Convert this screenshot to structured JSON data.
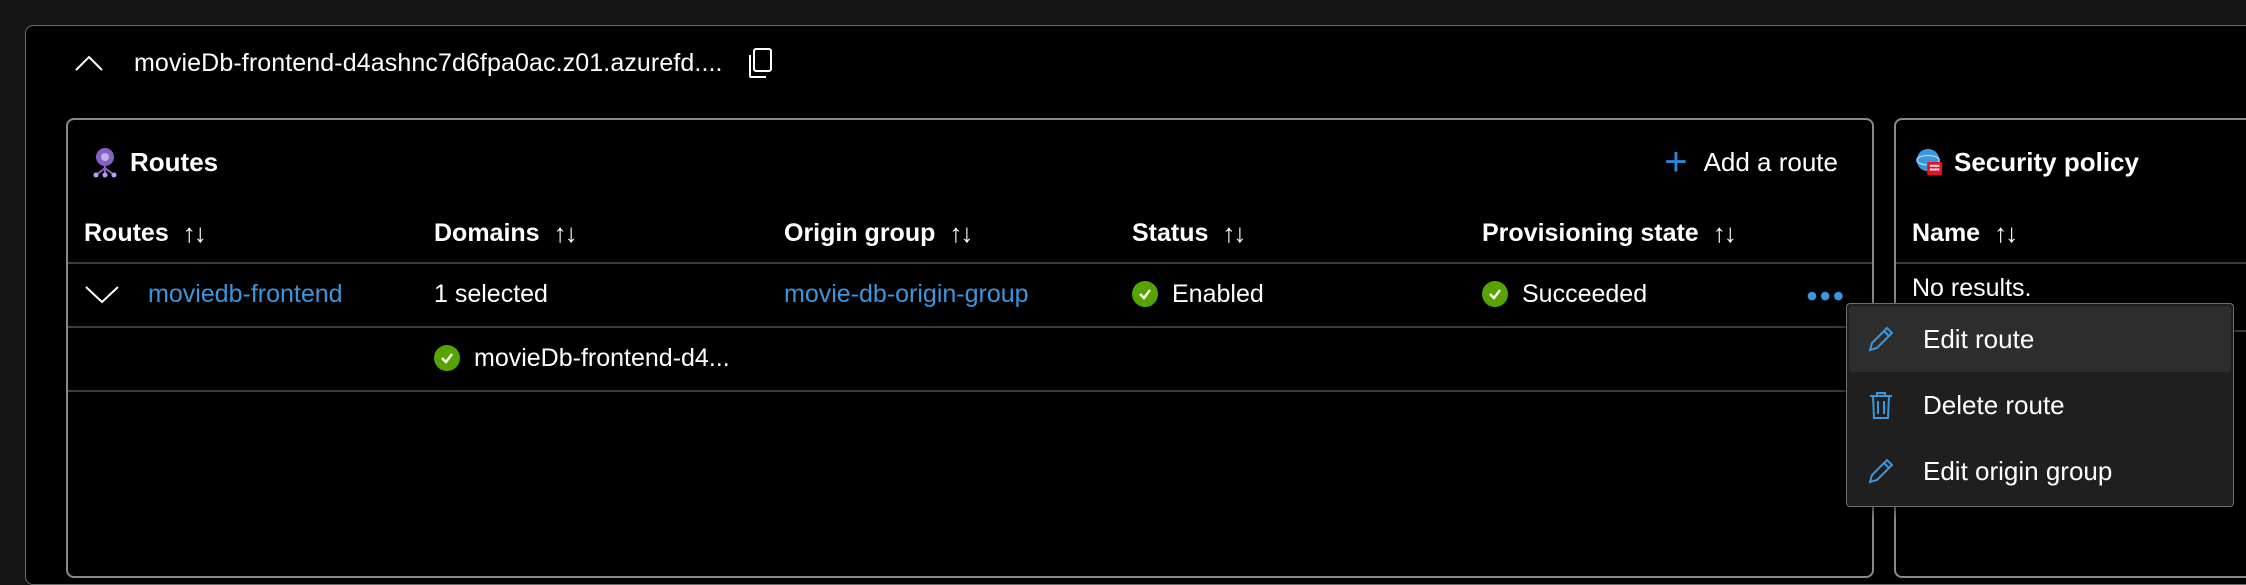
{
  "endpoint": {
    "title": "movieDb-frontend-d4ashnc7d6fpa0ac.z01.azurefd...."
  },
  "routes_card": {
    "title": "Routes",
    "add_label": "Add a route",
    "columns": [
      "Routes",
      "Domains",
      "Origin group",
      "Status",
      "Provisioning state"
    ],
    "sort_glyph": "↑↓",
    "rows": [
      {
        "route": "moviedb-frontend",
        "domains": "1 selected",
        "origin_group": "movie-db-origin-group",
        "status": "Enabled",
        "provisioning_state": "Succeeded"
      }
    ],
    "expanded_domain": "movieDb-frontend-d4..."
  },
  "security_card": {
    "title": "Security policy",
    "column": "Name",
    "empty_text": "No results."
  },
  "context_menu": {
    "items": [
      {
        "label": "Edit route",
        "icon": "pencil-icon"
      },
      {
        "label": "Delete route",
        "icon": "trash-icon"
      },
      {
        "label": "Edit origin group",
        "icon": "pencil-icon"
      }
    ]
  },
  "colors": {
    "accent": "#3a96dd",
    "success": "#57a300",
    "background": "#000000"
  }
}
